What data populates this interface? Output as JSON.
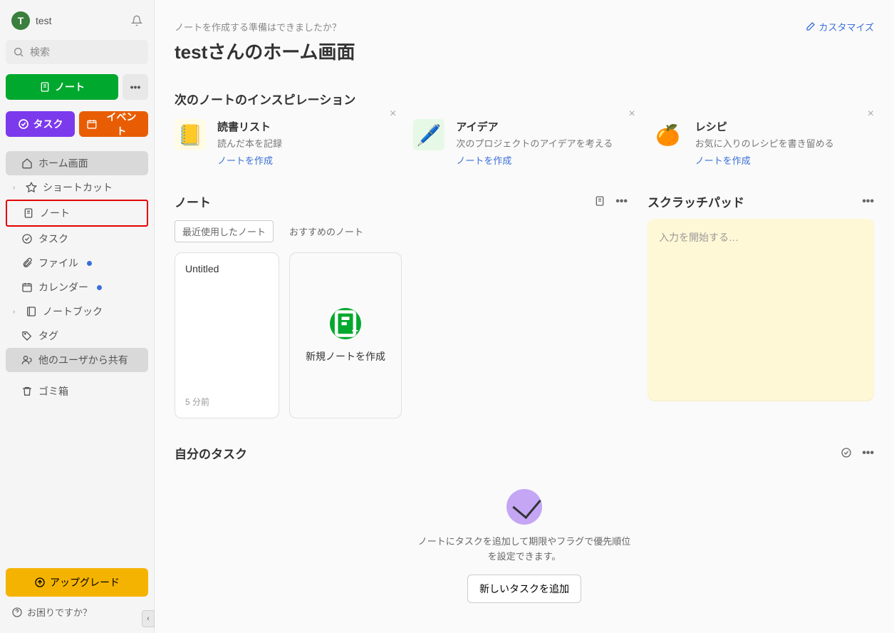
{
  "user": {
    "initial": "T",
    "name": "test"
  },
  "search": {
    "placeholder": "検索"
  },
  "buttons": {
    "new_note": "ノート",
    "task": "タスク",
    "event": "イベント"
  },
  "nav": {
    "home": "ホーム画面",
    "shortcuts": "ショートカット",
    "notes": "ノート",
    "tasks": "タスク",
    "files": "ファイル",
    "calendar": "カレンダー",
    "notebooks": "ノートブック",
    "tags": "タグ",
    "shared": "他のユーザから共有",
    "trash": "ゴミ箱"
  },
  "upgrade": "アップグレード",
  "help": "お困りですか？",
  "header": {
    "sub": "ノートを作成する準備はできましたか？",
    "title": "testさんのホーム画面",
    "customize": "カスタマイズ"
  },
  "inspiration": {
    "title": "次のノートのインスピレーション",
    "cards": [
      {
        "title": "読書リスト",
        "desc": "読んだ本を記録",
        "link": "ノートを作成"
      },
      {
        "title": "アイデア",
        "desc": "次のプロジェクトのアイデアを考える",
        "link": "ノートを作成"
      },
      {
        "title": "レシピ",
        "desc": "お気に入りのレシピを書き留める",
        "link": "ノートを作成"
      }
    ]
  },
  "notes": {
    "title": "ノート",
    "tabs": {
      "recent": "最近使用したノート",
      "suggested": "おすすめのノート"
    },
    "cards": [
      {
        "title": "Untitled",
        "time": "5 分前"
      }
    ],
    "new_label": "新規ノートを作成"
  },
  "scratchpad": {
    "title": "スクラッチパッド",
    "placeholder": "入力を開始する…"
  },
  "tasks": {
    "title": "自分のタスク",
    "empty_msg": "ノートにタスクを追加して期限やフラグで優先順位を設定できます。",
    "add_btn": "新しいタスクを追加"
  }
}
